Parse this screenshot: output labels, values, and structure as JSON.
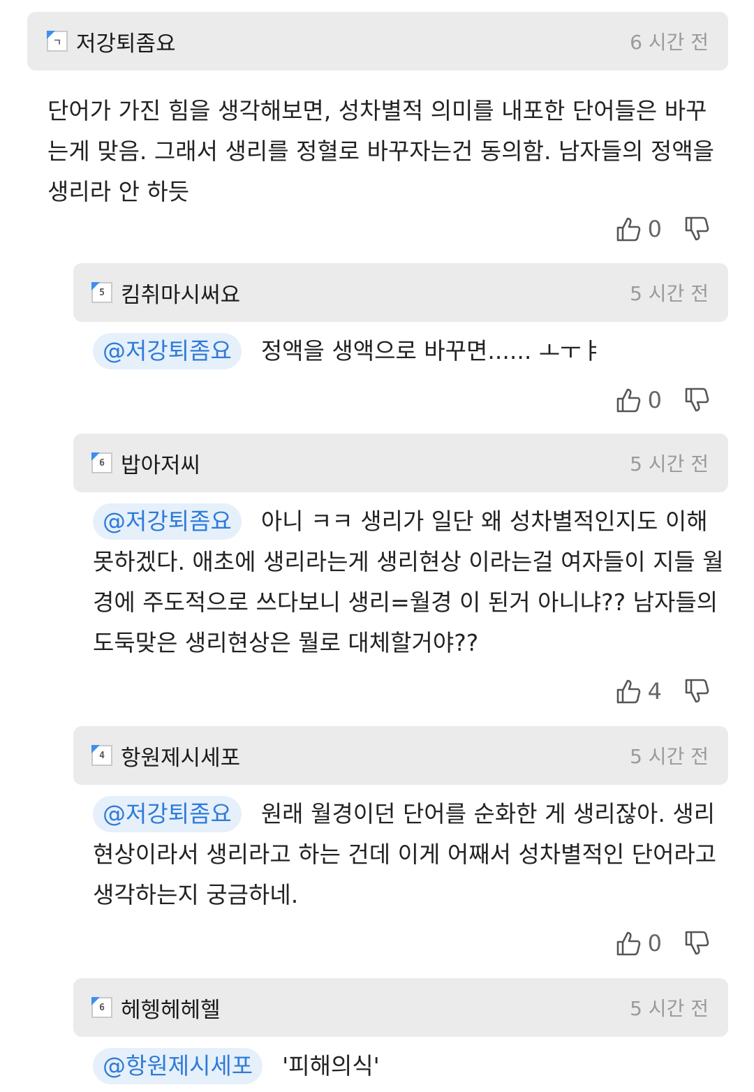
{
  "comments": [
    {
      "level_badge": "ㄱ",
      "nickname": "저강퇴좀요",
      "time": "6 시간 전",
      "text": "단어가 가진 힘을 생각해보면, 성차별적 의미를 내포한 단어들은 바꾸는게 맞음. 그래서 생리를 정혈로 바꾸자는건 동의함. 남자들의 정액을 생리라 안 하듯",
      "likes": "0",
      "like_icon": "thumbs-up-icon",
      "dislike_icon": "thumbs-down-icon"
    },
    {
      "level_badge": "5",
      "nickname": "킴취마시써요",
      "time": "5 시간 전",
      "mention": "@저강퇴좀요",
      "text": "정액을 생액으로 바꾸면...... ㅗㅜㅑ",
      "likes": "0"
    },
    {
      "level_badge": "6",
      "nickname": "밥아저씨",
      "time": "5 시간 전",
      "mention": "@저강퇴좀요",
      "text": "아니 ㅋㅋ 생리가 일단 왜 성차별적인지도 이해 못하겠다. 애초에 생리라는게 생리현상 이라는걸 여자들이 지들 월경에 주도적으로 쓰다보니 생리=월경 이 된거 아니냐?? 남자들의 도둑맞은 생리현상은 뭘로 대체할거야??",
      "likes": "4"
    },
    {
      "level_badge": "4",
      "nickname": "항원제시세포",
      "time": "5 시간 전",
      "mention": "@저강퇴좀요",
      "text": "원래 월경이던 단어를 순화한 게 생리잖아. 생리현상이라서 생리라고 하는 건데 이게 어째서 성차별적인 단어라고 생각하는지 궁금하네.",
      "likes": "0"
    },
    {
      "level_badge": "6",
      "nickname": "헤헹헤헤헬",
      "time": "5 시간 전",
      "mention": "@항원제시세포",
      "text": "'피해의식'"
    }
  ]
}
